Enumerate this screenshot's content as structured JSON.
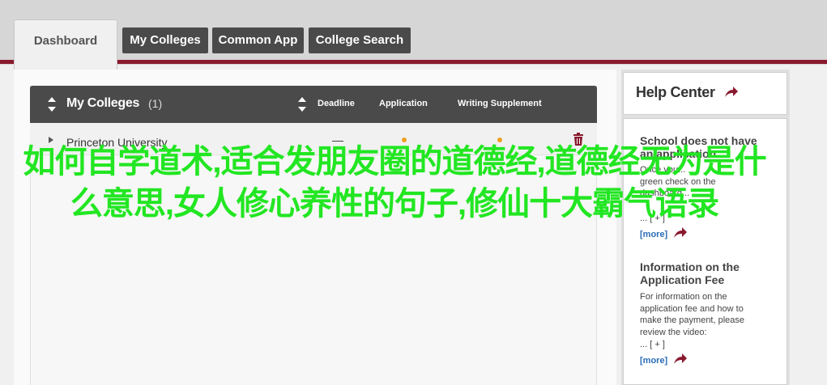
{
  "tabs": {
    "dashboard": "Dashboard",
    "my_colleges": "My Colleges",
    "common_app": "Common App",
    "college_search": "College Search"
  },
  "colleges": {
    "title": "My Colleges",
    "count": "(1)",
    "columns": {
      "deadline": "Deadline",
      "application": "Application",
      "writing": "Writing Supplement"
    },
    "rows": [
      {
        "name": "Princeton University",
        "deadline": "—"
      }
    ]
  },
  "help": {
    "title": "Help Center",
    "articles": [
      {
        "title_lines": [
          "School does not have",
          "an application"
        ],
        "body_lines": [
          "Once you...",
          "green check on the",
          "dashboard...",
          "... [ + ]"
        ],
        "toggle": "... [ + ]",
        "more": "[more]"
      },
      {
        "title_lines": [
          "Information on the",
          "Application Fee"
        ],
        "body_lines": [
          "For information on the",
          "application fee and how to",
          "make the payment, please",
          "review the video:"
        ],
        "toggle": "... [ + ]",
        "more": "[more]"
      }
    ]
  },
  "overlay": {
    "text": "如何自学道术,适合发朋友圈的道德经,道德经无为是什么意思,女人修心养性的句子,修仙十大霸气语录"
  },
  "colors": {
    "accent": "#8a1a2e",
    "overlay": "#22e622",
    "link": "#2a6db5",
    "dot": "#f0a020"
  }
}
